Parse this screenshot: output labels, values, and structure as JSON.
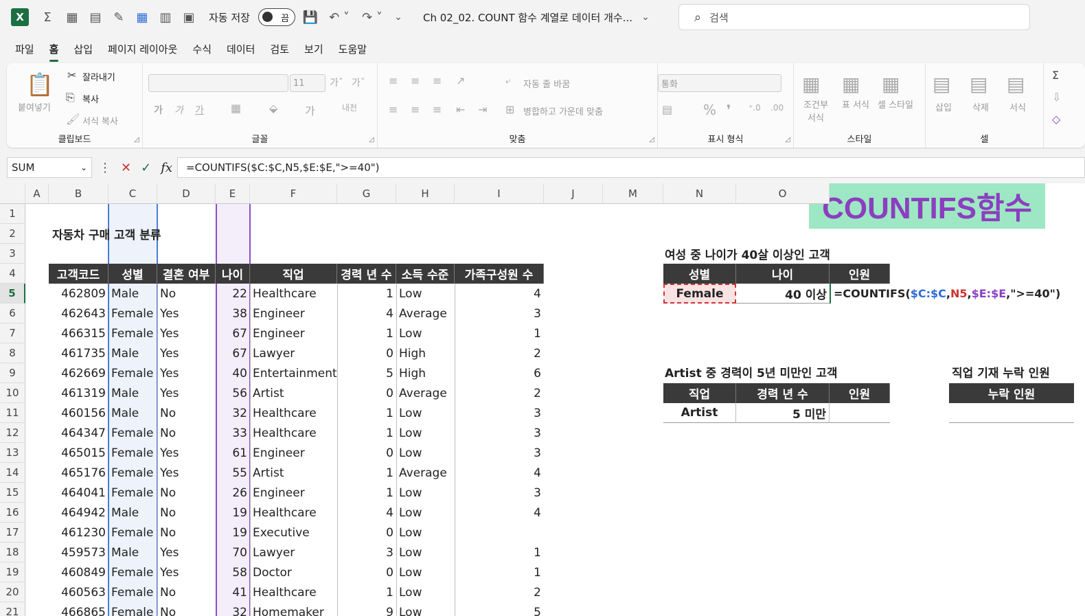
{
  "titlebar": {
    "app_logo": "X",
    "autosave_label": "자동 저장",
    "autosave_state": "끔",
    "doc_title": "Ch 02_02. COUNT 함수 계열로 데이터 개수...",
    "search_placeholder": "검색"
  },
  "menu": [
    "파일",
    "홈",
    "삽입",
    "페이지 레이아웃",
    "수식",
    "데이터",
    "검토",
    "보기",
    "도움말"
  ],
  "ribbon": {
    "clipboard": {
      "paste": "붙여넣기",
      "cut": "잘라내기",
      "copy": "복사",
      "format_painter": "서식 복사",
      "label": "클립보드"
    },
    "font": {
      "size": "11",
      "label": "글꼴"
    },
    "alignment": {
      "wrap": "자동 줄 바꿈",
      "merge": "병합하고 가운데 맞춤",
      "label": "맞춤"
    },
    "number": {
      "format": "통화",
      "label": "표시 형식"
    },
    "styles": {
      "conditional": "조건부 서식",
      "table": "표 서식",
      "cell": "셀 스타일",
      "label": "스타일"
    },
    "cells": {
      "insert": "삽입",
      "delete": "삭제",
      "format": "서식",
      "label": "셀"
    }
  },
  "formula_bar": {
    "name_box": "SUM",
    "formula": "=COUNTIFS($C:$C,N5,$E:$E,\">=40\")"
  },
  "columns": [
    "A",
    "B",
    "C",
    "D",
    "E",
    "F",
    "G",
    "H",
    "I",
    "J",
    "M",
    "N",
    "O"
  ],
  "rows": [
    "1",
    "2",
    "3",
    "4",
    "5",
    "6",
    "7",
    "8",
    "9",
    "10",
    "11",
    "12",
    "13",
    "14",
    "15",
    "16",
    "17",
    "18",
    "19",
    "20",
    "21"
  ],
  "sheet": {
    "title": "자동차 구매 고객 분류",
    "headers": [
      "고객코드",
      "성별",
      "결혼 여부",
      "나이",
      "직업",
      "경력 년 수",
      "소득 수준",
      "가족구성원 수"
    ],
    "data": [
      [
        "462809",
        "Male",
        "No",
        "22",
        "Healthcare",
        "1",
        "Low",
        "4"
      ],
      [
        "462643",
        "Female",
        "Yes",
        "38",
        "Engineer",
        "4",
        "Average",
        "3"
      ],
      [
        "466315",
        "Female",
        "Yes",
        "67",
        "Engineer",
        "1",
        "Low",
        "1"
      ],
      [
        "461735",
        "Male",
        "Yes",
        "67",
        "Lawyer",
        "0",
        "High",
        "2"
      ],
      [
        "462669",
        "Female",
        "Yes",
        "40",
        "Entertainment",
        "5",
        "High",
        "6"
      ],
      [
        "461319",
        "Male",
        "Yes",
        "56",
        "Artist",
        "0",
        "Average",
        "2"
      ],
      [
        "460156",
        "Male",
        "No",
        "32",
        "Healthcare",
        "1",
        "Low",
        "3"
      ],
      [
        "464347",
        "Female",
        "No",
        "33",
        "Healthcare",
        "1",
        "Low",
        "3"
      ],
      [
        "465015",
        "Female",
        "Yes",
        "61",
        "Engineer",
        "0",
        "Low",
        "3"
      ],
      [
        "465176",
        "Female",
        "Yes",
        "55",
        "Artist",
        "1",
        "Average",
        "4"
      ],
      [
        "464041",
        "Female",
        "No",
        "26",
        "Engineer",
        "1",
        "Low",
        "3"
      ],
      [
        "464942",
        "Male",
        "No",
        "19",
        "Healthcare",
        "4",
        "Low",
        "4"
      ],
      [
        "461230",
        "Female",
        "No",
        "19",
        "Executive",
        "0",
        "Low",
        ""
      ],
      [
        "459573",
        "Male",
        "Yes",
        "70",
        "Lawyer",
        "3",
        "Low",
        "1"
      ],
      [
        "460849",
        "Female",
        "Yes",
        "58",
        "Doctor",
        "0",
        "Low",
        "1"
      ],
      [
        "460563",
        "Female",
        "No",
        "41",
        "Healthcare",
        "1",
        "Low",
        "2"
      ],
      [
        "466865",
        "Female",
        "No",
        "32",
        "Homemaker",
        "9",
        "Low",
        "5"
      ]
    ],
    "banner": "COUNTIFS함수",
    "q1": {
      "title": "여성 중 나이가 40살 이상인 고객",
      "headers": [
        "성별",
        "나이",
        "인원"
      ],
      "gender": "Female",
      "age": "40 이상",
      "formula_parts": [
        "=COUNTIFS(",
        "$C:$C",
        ",",
        "N5",
        ",",
        "$E:$E",
        ",\">=40\")"
      ]
    },
    "q2": {
      "title": "Artist 중 경력이 5년 미만인 고객",
      "headers": [
        "직업",
        "경력 년 수",
        "인원"
      ],
      "job": "Artist",
      "years": "5 미만"
    },
    "q3": {
      "title": "직업 기재 누락 인원",
      "header": "누락 인원"
    }
  }
}
